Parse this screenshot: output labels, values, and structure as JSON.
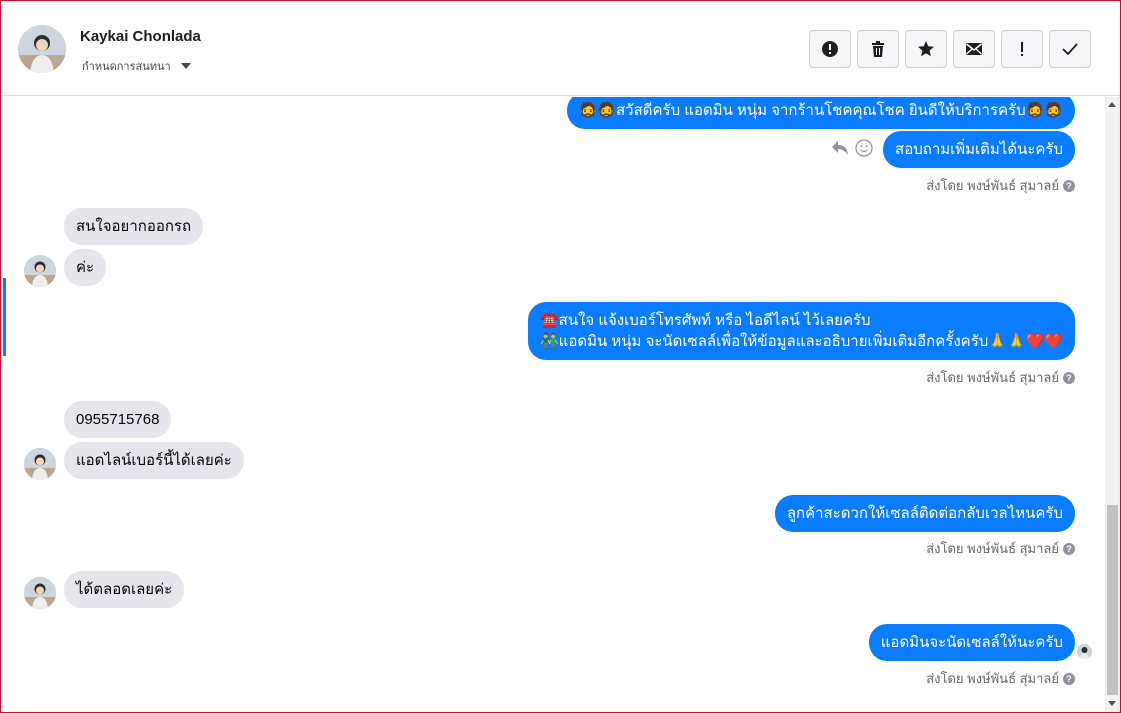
{
  "contact": {
    "name": "Kaykai Chonlada",
    "assign_label": "กำหนดการสนทนา"
  },
  "actions": [
    {
      "icon": "alert-circle-icon"
    },
    {
      "icon": "trash-icon"
    },
    {
      "icon": "star-icon"
    },
    {
      "icon": "mail-icon"
    },
    {
      "icon": "exclamation-icon"
    },
    {
      "icon": "check-icon"
    }
  ],
  "messages": {
    "out_1": "🧔🧔สวัสดีครับ แอดมิน หนุ่ม จากร้านโชคคุณโชค ยินดีให้บริการครับ🧔🧔",
    "out_2": "สอบถามเพิ่มเติมได้นะครับ",
    "in_1": "สนใจอยากออกรถ",
    "in_2": "ค่ะ",
    "out_3_line1": "☎️สนใจ แจ้งเบอร์โทรศัพท์ หรือ ไอดีไลน์  ไว้เลยครับ",
    "out_3_line2": "👬แอดมิน หนุ่ม จะนัดเซลล์เพื่อให้ข้อมูลและอธิบายเพิ่มเติมอีกครั้งครับ🙏🙏❤️❤️",
    "in_3": "0955715768",
    "in_4": "แอดไลน์เบอร์นี้ได้เลยค่ะ",
    "out_4": "ลูกค้าสะดวกให้เซลล์ติดต่อกลับเวลไหนครับ",
    "in_5": "ได้ตลอดเลยค่ะ",
    "out_5": "แอดมินจะนัดเซลล์ให้นะครับ"
  },
  "sent_by": "ส่งโดย พงษ์พันธ์ สุมาลย์",
  "colors": {
    "outgoing_bubble": "#0a7cff",
    "incoming_bubble": "#e4e6eb",
    "border": "#c8102e"
  }
}
